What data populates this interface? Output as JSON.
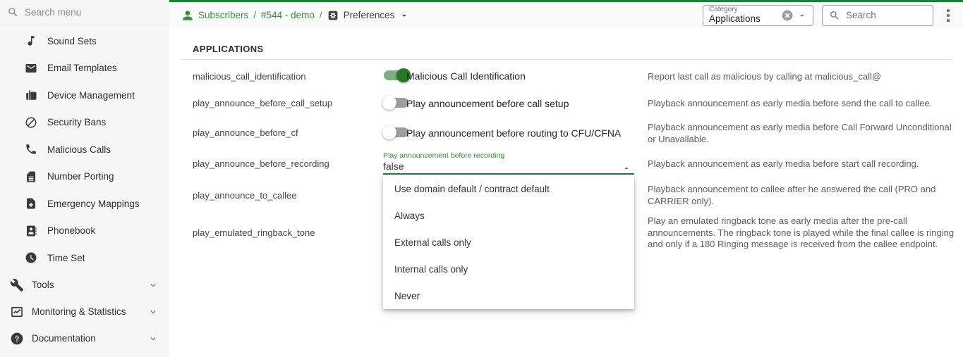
{
  "colors": {
    "accent_green": "#388e3c",
    "top_line_green": "#1e7e34",
    "toggle_on_knob": "#25772a",
    "toggle_on_track": "#7fae82",
    "toggle_off_track": "#9e9e9e"
  },
  "icons": {
    "sidebar_search": "magnifier-icon",
    "help_glyph": "?",
    "names": [
      "music-note-icon",
      "envelope-icon",
      "fax-device-icon",
      "block-icon",
      "phone-icon",
      "sim-card-icon",
      "file-plus-icon",
      "contact-book-icon",
      "clock-icon",
      "tools-icon",
      "chart-icon",
      "help-circle-icon",
      "person-icon",
      "settings-square-icon",
      "triangle-down-icon",
      "triangle-up-icon",
      "clear-circle-icon",
      "kebab-menu-icon",
      "chevron-down-icon"
    ]
  },
  "sidebar": {
    "search_placeholder": "Search menu",
    "items": [
      {
        "label": "Sound Sets"
      },
      {
        "label": "Email Templates"
      },
      {
        "label": "Device Management"
      },
      {
        "label": "Security Bans"
      },
      {
        "label": "Malicious Calls"
      },
      {
        "label": "Number Porting"
      },
      {
        "label": "Emergency Mappings"
      },
      {
        "label": "Phonebook"
      },
      {
        "label": "Time Set"
      }
    ],
    "sections": [
      {
        "label": "Tools"
      },
      {
        "label": "Monitoring & Statistics"
      },
      {
        "label": "Documentation"
      }
    ]
  },
  "toolbar": {
    "breadcrumb_separator": "/",
    "breadcrumb": [
      {
        "label": "Subscribers"
      },
      {
        "label": "#544 - demo"
      },
      {
        "label": "Preferences"
      }
    ],
    "category": {
      "label": "Category",
      "value": "Applications"
    },
    "search_placeholder": "Search"
  },
  "main": {
    "section_title": "APPLICATIONS",
    "rows": [
      {
        "key": "malicious_call_identification",
        "control": "toggle",
        "state": "on",
        "label": "Malicious Call Identification",
        "description": "Report last call as malicious by calling at malicious_call@"
      },
      {
        "key": "play_announce_before_call_setup",
        "control": "toggle",
        "state": "off",
        "label": "Play announcement before call setup",
        "description": "Playback announcement as early media before send the call to callee."
      },
      {
        "key": "play_announce_before_cf",
        "control": "toggle",
        "state": "off",
        "label": "Play announcement before routing to CFU/CFNA",
        "description": "Playback announcement as early media before Call Forward Unconditional or Unavailable."
      },
      {
        "key": "play_announce_before_recording",
        "control": "select",
        "field_label": "Play announcement before recording",
        "value": "false",
        "description": "Playback announcement as early media before start call recording."
      },
      {
        "key": "play_announce_to_callee",
        "description": "Playback announcement to callee after he answered the call (PRO and CARRIER only)."
      },
      {
        "key": "play_emulated_ringback_tone",
        "description": "Play an emulated ringback tone as early media after the pre-call announcements. The ringback tone is played while the final callee is ringing and only if a 180 Ringing message is received from the callee endpoint."
      }
    ],
    "dropdown_options": [
      {
        "label": "Use domain default / contract default"
      },
      {
        "label": "Always"
      },
      {
        "label": "External calls only"
      },
      {
        "label": "Internal calls only"
      },
      {
        "label": "Never"
      }
    ]
  }
}
